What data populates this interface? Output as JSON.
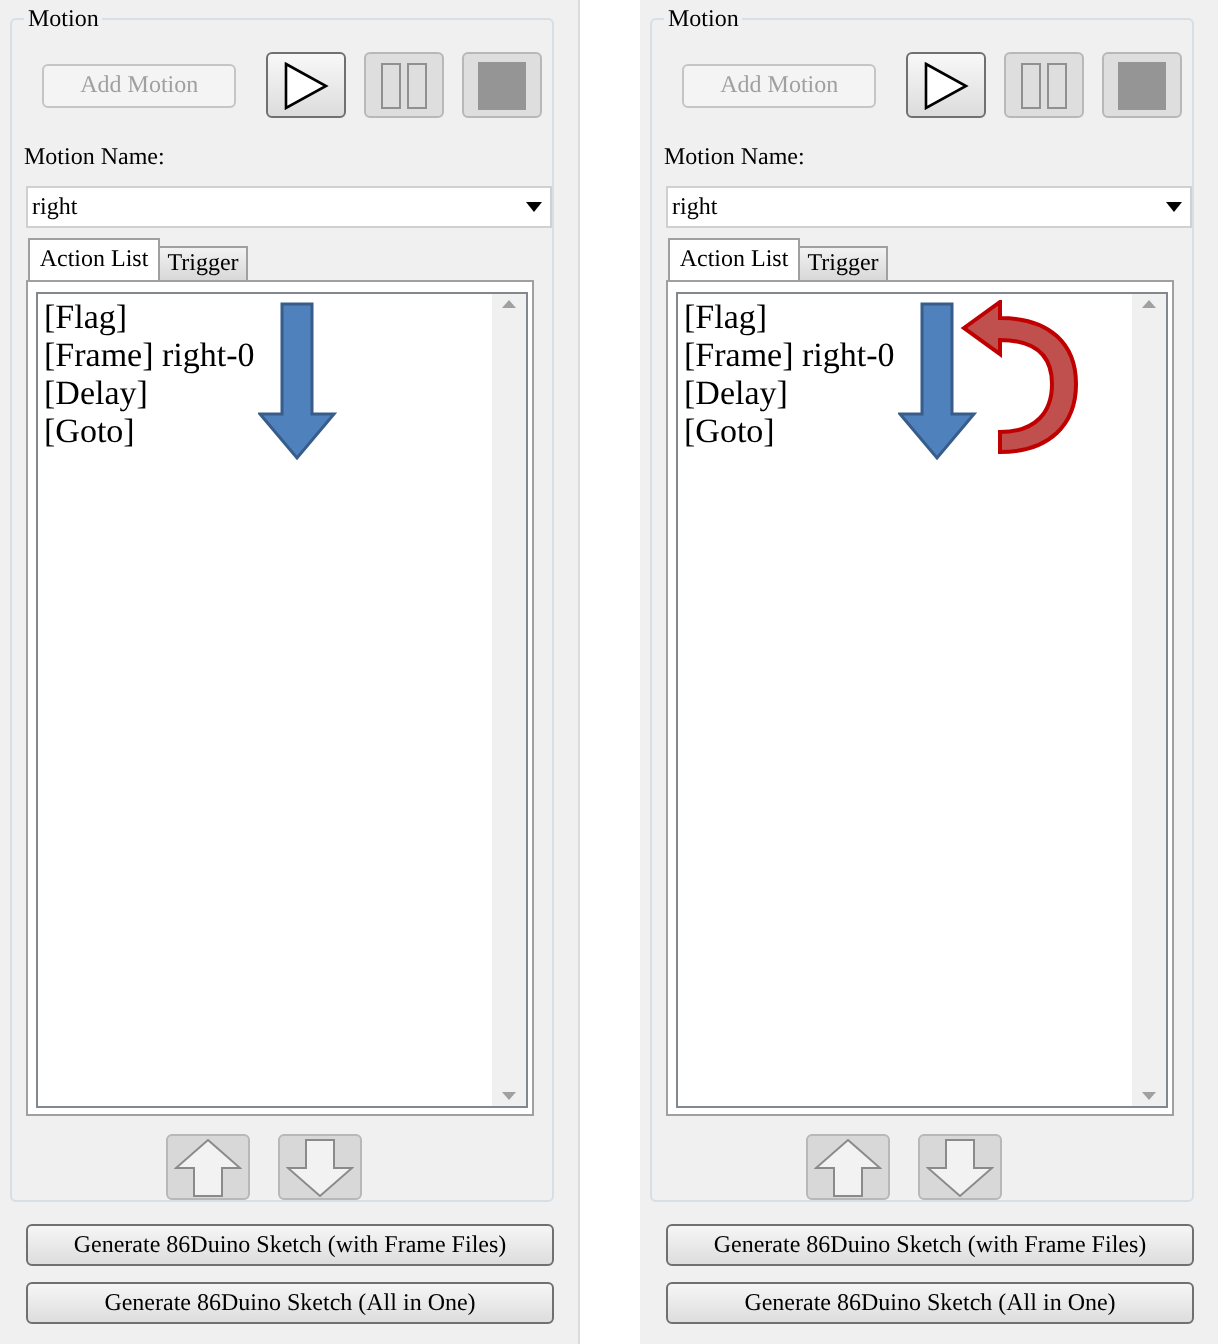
{
  "panels": [
    {
      "group_title": "Motion",
      "add_motion_button": {
        "label": "Add Motion",
        "disabled": true
      },
      "transport_buttons": [
        {
          "kind": "play",
          "disabled": false
        },
        {
          "kind": "pause",
          "disabled": true
        },
        {
          "kind": "stop",
          "disabled": true
        }
      ],
      "motion_name_label": "Motion Name:",
      "motion_name_value": "right",
      "tabs": [
        {
          "label": "Action List",
          "selected": true
        },
        {
          "label": "Trigger",
          "selected": false
        }
      ],
      "actions": [
        "[Flag]",
        "[Frame] right-0",
        "[Delay]",
        "[Goto]"
      ],
      "annotations": [
        {
          "kind": "down-arrow"
        }
      ],
      "move_buttons": [
        {
          "kind": "up"
        },
        {
          "kind": "down"
        }
      ],
      "generate_buttons": [
        "Generate 86Duino Sketch (with Frame Files)",
        "Generate 86Duino Sketch (All in One)"
      ]
    },
    {
      "group_title": "Motion",
      "add_motion_button": {
        "label": "Add Motion",
        "disabled": true
      },
      "transport_buttons": [
        {
          "kind": "play",
          "disabled": false
        },
        {
          "kind": "pause",
          "disabled": true
        },
        {
          "kind": "stop",
          "disabled": true
        }
      ],
      "motion_name_label": "Motion Name:",
      "motion_name_value": "right",
      "tabs": [
        {
          "label": "Action List",
          "selected": true
        },
        {
          "label": "Trigger",
          "selected": false
        }
      ],
      "actions": [
        "[Flag]",
        "[Frame] right-0",
        "[Delay]",
        "[Goto]"
      ],
      "annotations": [
        {
          "kind": "down-arrow"
        },
        {
          "kind": "loop-arrow"
        }
      ],
      "move_buttons": [
        {
          "kind": "up"
        },
        {
          "kind": "down"
        }
      ],
      "generate_buttons": [
        "Generate 86Duino Sketch (with Frame Files)",
        "Generate 86Duino Sketch (All in One)"
      ]
    }
  ]
}
